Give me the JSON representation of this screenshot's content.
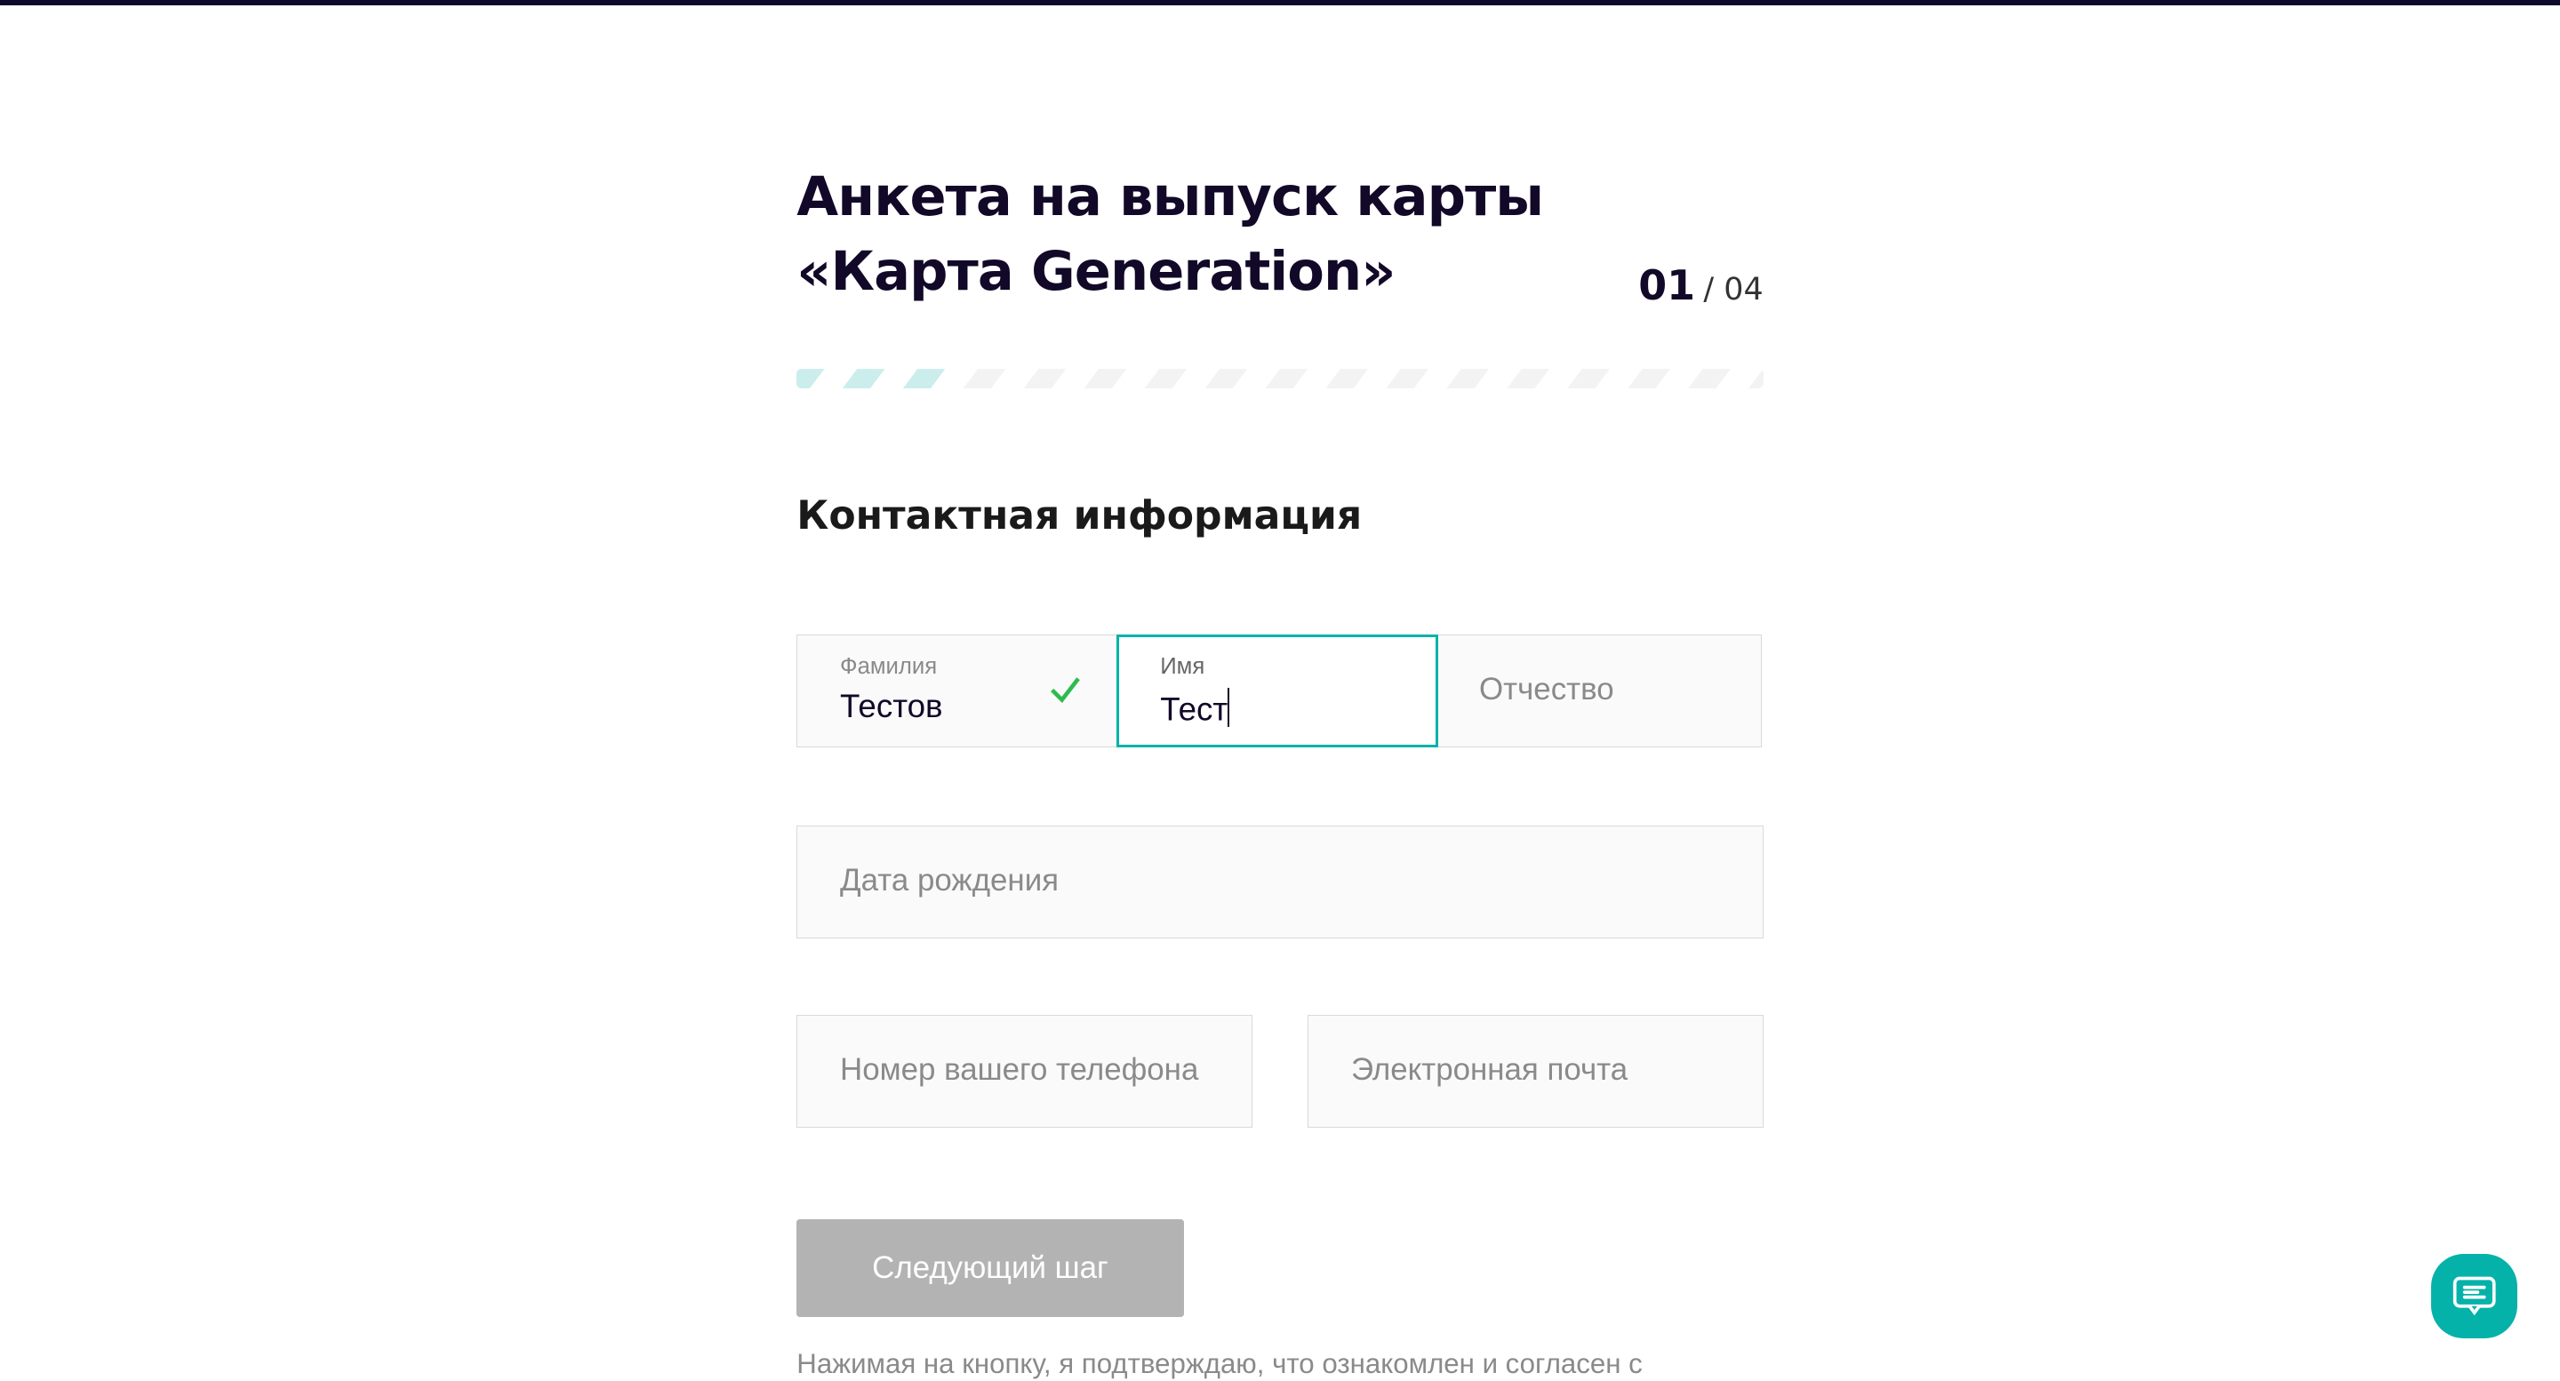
{
  "header": {
    "title": "Анкета на выпуск карты «Карта Generation»",
    "step_current": "01",
    "step_total": "/ 04",
    "progress_fraction": 0.16
  },
  "section_title": "Контактная информация",
  "fields": {
    "last_name": {
      "label": "Фамилия",
      "value": "Тестов",
      "status_icon": "check-icon"
    },
    "first_name": {
      "label": "Имя",
      "value": "Тест"
    },
    "middle_name": {
      "placeholder": "Отчество"
    },
    "birth_date": {
      "placeholder": "Дата рождения"
    },
    "phone": {
      "placeholder": "Номер вашего телефона"
    },
    "email": {
      "placeholder": "Электронная почта"
    }
  },
  "next_button_label": "Следующий шаг",
  "consent_note": "Нажимая на кнопку, я подтверждаю, что ознакомлен и согласен с",
  "colors": {
    "accent": "#05b2a9",
    "check": "#2dbb4e",
    "text": "#120828",
    "button_disabled": "#b3b3b3"
  },
  "chat_icon": "chat-bubble-icon"
}
